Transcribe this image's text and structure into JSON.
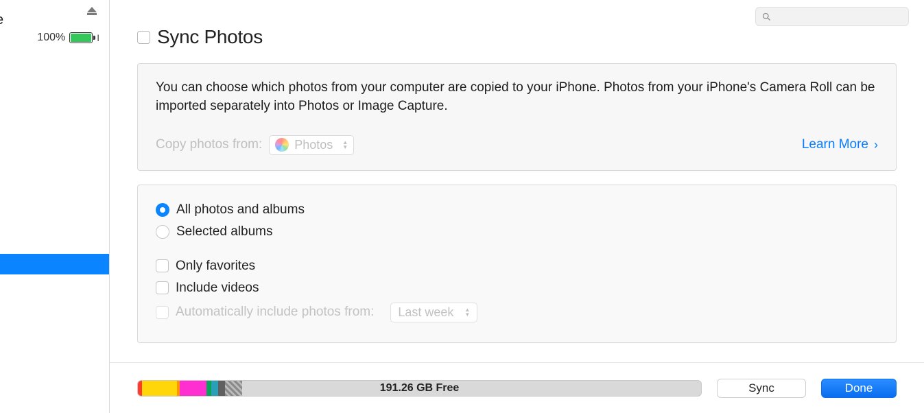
{
  "sidebar": {
    "battery_pct": "100%"
  },
  "search": {
    "placeholder": ""
  },
  "title": "Sync Photos",
  "desc": "You can choose which photos from your computer are copied to your iPhone. Photos from your iPhone's Camera Roll can be imported separately into Photos or Image Capture.",
  "copy_from_label": "Copy photos from:",
  "copy_from_select": "Photos",
  "learn_more": "Learn More",
  "opts": {
    "all": "All photos and albums",
    "selected": "Selected albums",
    "favorites": "Only favorites",
    "videos": "Include videos",
    "auto_label": "Automatically include photos from:",
    "auto_select": "Last week"
  },
  "footer": {
    "free": "191.26 GB Free",
    "sync": "Sync",
    "done": "Done"
  }
}
